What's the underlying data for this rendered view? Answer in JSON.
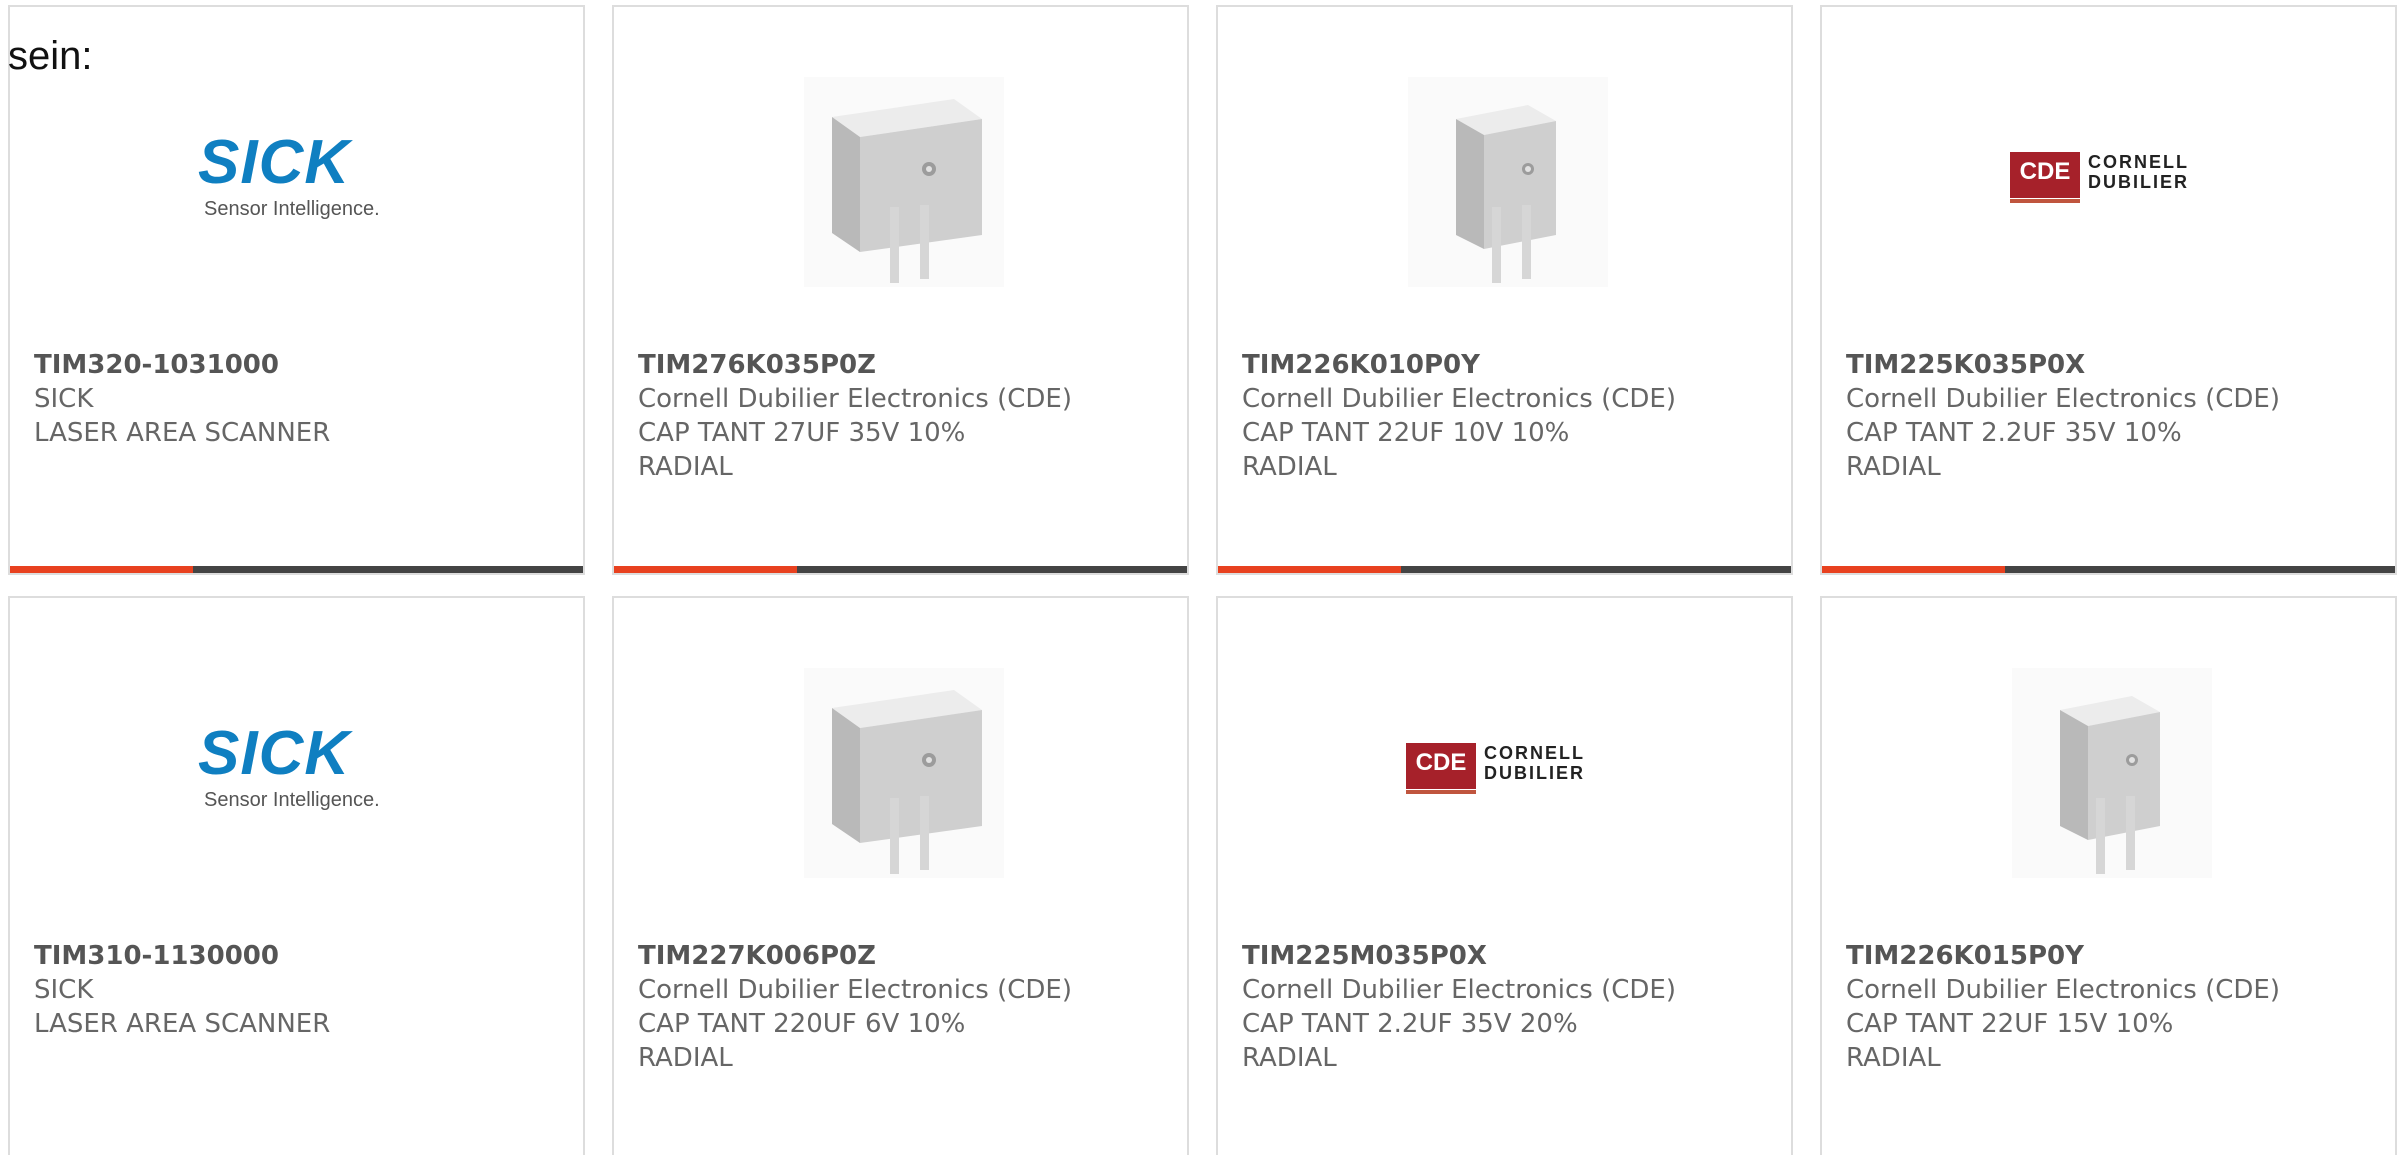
{
  "intro_text": "sein:",
  "products": [
    {
      "part_number": "TIM320-1031000",
      "manufacturer": "SICK",
      "description": [
        "LASER AREA SCANNER"
      ],
      "image": "sick-logo",
      "logo_text": "SICK",
      "logo_tagline": "Sensor Intelligence."
    },
    {
      "part_number": "TIM276K035P0Z",
      "manufacturer": "Cornell Dubilier Electronics (CDE)",
      "description": [
        "CAP TANT 27UF 35V 10%",
        "RADIAL"
      ],
      "image": "capacitor-wide"
    },
    {
      "part_number": "TIM226K010P0Y",
      "manufacturer": "Cornell Dubilier Electronics (CDE)",
      "description": [
        "CAP TANT 22UF 10V 10%",
        "RADIAL"
      ],
      "image": "capacitor-narrow"
    },
    {
      "part_number": "TIM225K035P0X",
      "manufacturer": "Cornell Dubilier Electronics (CDE)",
      "description": [
        "CAP TANT 2.2UF 35V 10%",
        "RADIAL"
      ],
      "image": "cde-logo",
      "logo_text": "CDE",
      "logo_name_lines": [
        "CORNELL",
        "DUBILIER"
      ]
    },
    {
      "part_number": "TIM310-1130000",
      "manufacturer": "SICK",
      "description": [
        "LASER AREA SCANNER"
      ],
      "image": "sick-logo",
      "logo_text": "SICK",
      "logo_tagline": "Sensor Intelligence."
    },
    {
      "part_number": "TIM227K006P0Z",
      "manufacturer": "Cornell Dubilier Electronics (CDE)",
      "description": [
        "CAP TANT 220UF 6V 10%",
        "RADIAL"
      ],
      "image": "capacitor-wide"
    },
    {
      "part_number": "TIM225M035P0X",
      "manufacturer": "Cornell Dubilier Electronics (CDE)",
      "description": [
        "CAP TANT 2.2UF 35V 20%",
        "RADIAL"
      ],
      "image": "cde-logo",
      "logo_text": "CDE",
      "logo_name_lines": [
        "CORNELL",
        "DUBILIER"
      ]
    },
    {
      "part_number": "TIM226K015P0Y",
      "manufacturer": "Cornell Dubilier Electronics (CDE)",
      "description": [
        "CAP TANT 22UF 15V 10%",
        "RADIAL"
      ],
      "image": "capacitor-narrow"
    }
  ],
  "colors": {
    "accent": "#e8411f",
    "bar": "#444444",
    "card_border": "#dddddd",
    "sick_blue": "#0f7fc1",
    "cde_red": "#a6212a",
    "text_gray": "#666666"
  }
}
